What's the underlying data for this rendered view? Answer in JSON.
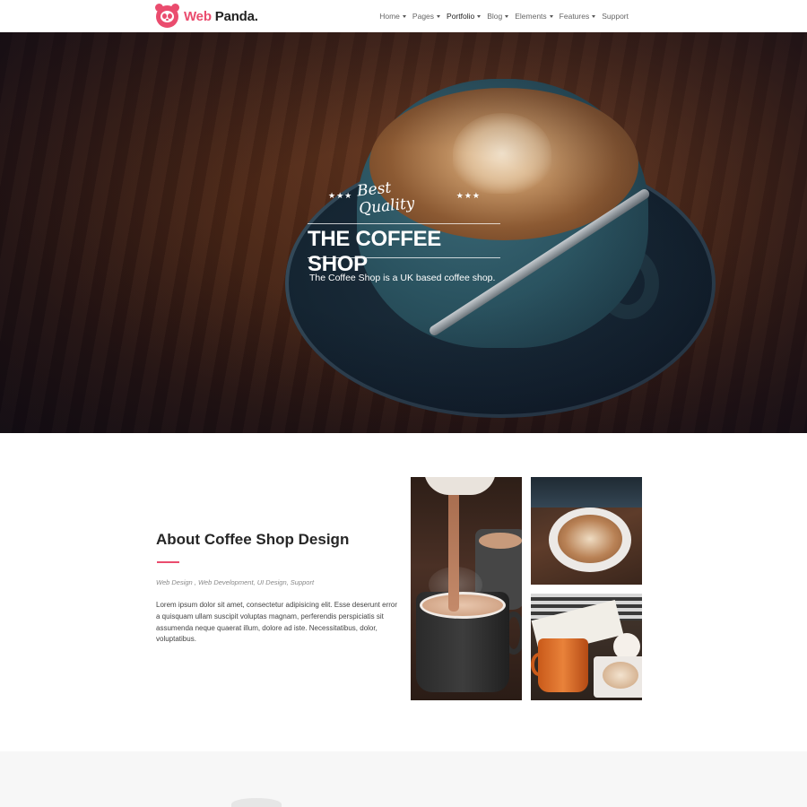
{
  "header": {
    "logo": {
      "brand_web": "Web",
      "brand_panda": "Panda."
    },
    "nav": [
      {
        "label": "Home",
        "dropdown": true,
        "active": false
      },
      {
        "label": "Pages",
        "dropdown": true,
        "active": false
      },
      {
        "label": "Portfolio",
        "dropdown": true,
        "active": true
      },
      {
        "label": "Blog",
        "dropdown": true,
        "active": false
      },
      {
        "label": "Elements",
        "dropdown": true,
        "active": false
      },
      {
        "label": "Features",
        "dropdown": true,
        "active": false
      },
      {
        "label": "Support",
        "dropdown": false,
        "active": false
      }
    ]
  },
  "hero": {
    "tagline": "Best Quality",
    "title": "THE COFFEE SHOP",
    "subtitle": "The Coffee Shop is a UK based coffee shop."
  },
  "about": {
    "title": "About Coffee Shop Design",
    "tags": "Web Design , Web Development, UI Design, Support",
    "body": "Lorem ipsum dolor sit amet, consectetur adipisicing elit. Esse deserunt error a quisquam ullam suscipit voluptas magnam, perferendis perspiciatis sit assumenda neque quaerat illum, dolore ad iste. Necessitatibus, dolor, voluptatibus."
  },
  "colors": {
    "accent": "#ea4c6e",
    "heading": "#262626",
    "band": "#f7f7f7"
  }
}
